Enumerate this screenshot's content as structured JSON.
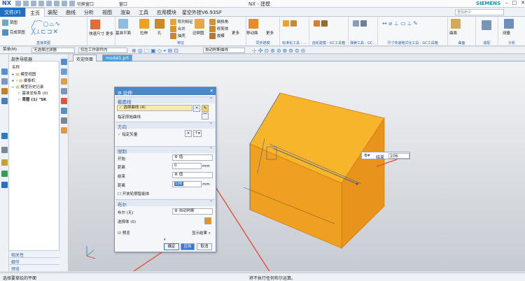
{
  "titlebar": {
    "logo": "NX",
    "quick1": "切换窗口",
    "quick2": "窗口",
    "center": "NX - 建模",
    "brand": "SIEMENS"
  },
  "menu": {
    "tabs": [
      "文件(F)",
      "主页",
      "装配",
      "曲线",
      "分析",
      "视图",
      "渲染",
      "工具",
      "应用模块",
      "星空外挂V6.93SF"
    ],
    "search_placeholder": "查找命令"
  },
  "ribbon": {
    "sketch": {
      "a": "草图",
      "b": "完成草图",
      "label": "直接草图"
    },
    "dim": {
      "a": "快速尺寸",
      "b": "更多"
    },
    "feature": {
      "a": "基准平面",
      "b": "拉伸",
      "c": "孔",
      "d": "阵列特征",
      "e": "合并",
      "f": "抽壳",
      "g": "边倒圆",
      "h": "倒斜角",
      "i": "修剪体",
      "j": "拔模",
      "k": "更多",
      "label": "特征"
    },
    "sync": {
      "a": "移动面",
      "b": "更多",
      "label": "同步建模"
    },
    "std": {
      "label": "标准化工具 - ..."
    },
    "gear": {
      "label": "齿轮建模 - GC工具箱"
    },
    "spring": {
      "label": "弹簧工具 - GC..."
    },
    "dimtool": {
      "label": "尺寸快速格式化工具 - GC工具箱"
    },
    "surface": {
      "a": "曲面",
      "label": "曲面"
    },
    "asm": {
      "label": "装配"
    },
    "analysis": {
      "a": "测量",
      "label": "分析"
    }
  },
  "filterbar": {
    "menu": "菜单(M)",
    "filter": "无选择过滤器",
    "scope": "仅在工作部件内",
    "snap": "自动判断曲线"
  },
  "doctabs": {
    "welcome": "欢迎页面",
    "model": "model1.prt"
  },
  "nav": {
    "title": "部件导航器",
    "col": "名称",
    "items": [
      "模型视图",
      "摄像机",
      "模型历史记录",
      "基准坐标系 (0)",
      "草图 (1) \"SK"
    ],
    "sections": [
      "相关性",
      "细节",
      "预览"
    ]
  },
  "dialog": {
    "title": "拉伸",
    "s1": "截面线",
    "selcurve": "选择曲线 (4)",
    "origin": "指定原始曲线",
    "s2": "方向",
    "vector": "指定矢量",
    "s3": "限制",
    "start_label": "开始",
    "start_val": "值",
    "dist1_label": "距离",
    "dist1_val": "0",
    "unit": "mm",
    "end_label": "结束",
    "end_val": "值",
    "dist2_label": "距离",
    "dist2_val": "106",
    "open_profile": "开放轮廓智能体",
    "s4": "布尔",
    "bool_label": "布尔 (无)",
    "bool_val": "自动判断",
    "selbody": "选择体 (0)",
    "preview": "预览",
    "show_result": "显示结果",
    "ok": "确定",
    "apply": "应用",
    "cancel": "取消"
  },
  "floating": {
    "label": "结束",
    "value": "106"
  },
  "status": {
    "left": "选择要草绘的平面",
    "mid": "将不执行任何布尔运算。"
  },
  "colors": {
    "accent": "#1f6fc2",
    "cube": "#f0a020",
    "cube_top": "#f7b52c",
    "arrow": "#e84a2c"
  }
}
